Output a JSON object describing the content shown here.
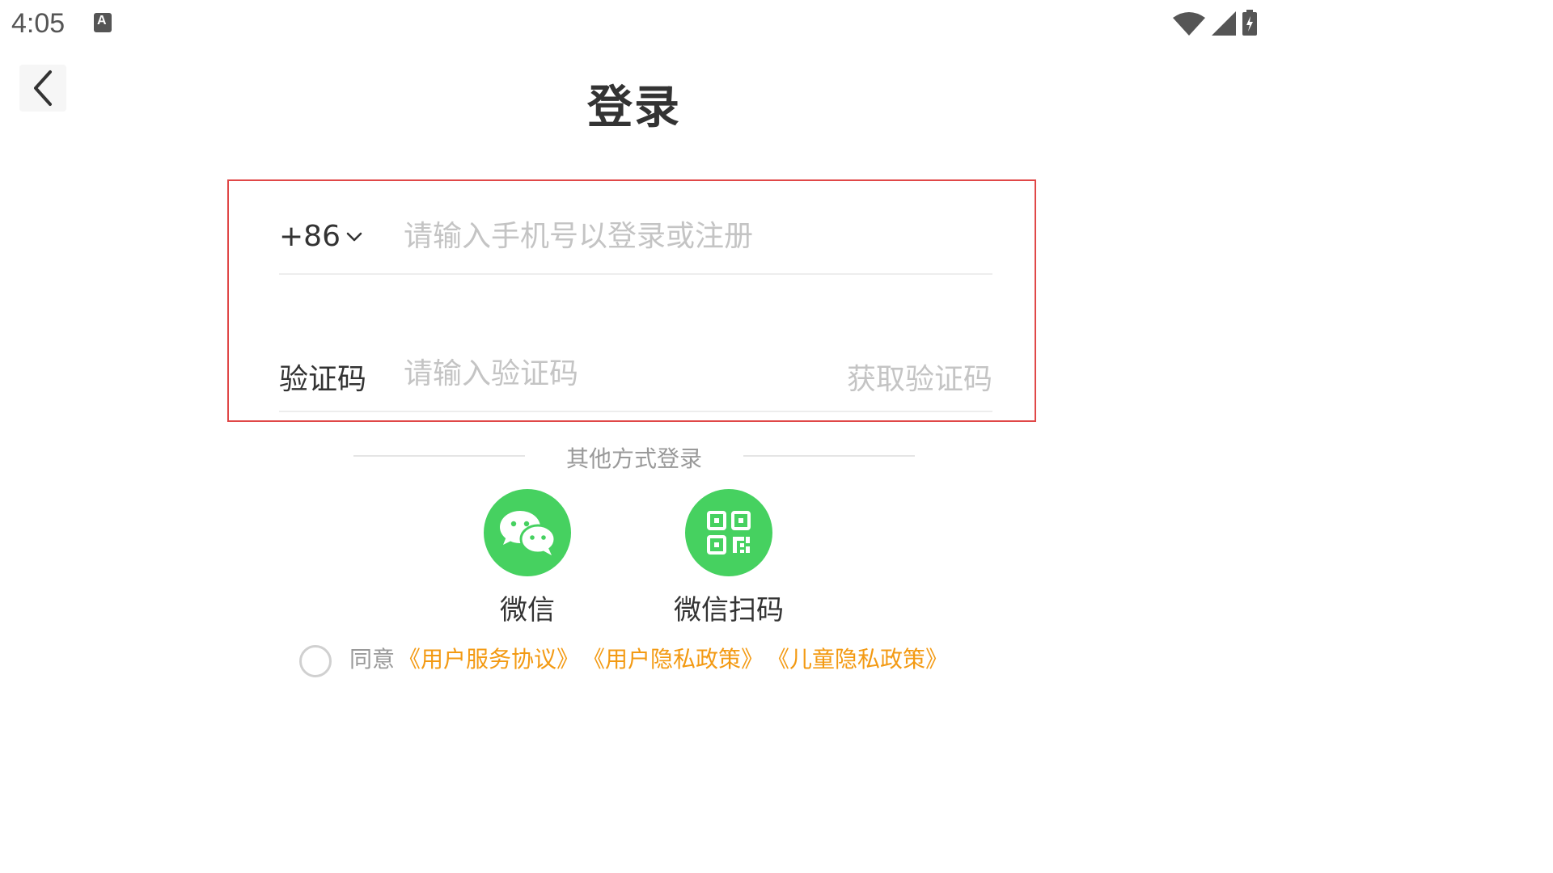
{
  "status_bar": {
    "time": "4:05"
  },
  "header": {
    "title": "登录"
  },
  "form": {
    "country_code": "+86",
    "phone_placeholder": "请输入手机号以登录或注册",
    "code_label": "验证码",
    "code_placeholder": "请输入验证码",
    "get_code_label": "获取验证码"
  },
  "other_login": {
    "label": "其他方式登录",
    "options": [
      {
        "label": "微信",
        "icon": "wechat-icon"
      },
      {
        "label": "微信扫码",
        "icon": "qr-code-icon"
      }
    ]
  },
  "agreement": {
    "prefix": "同意",
    "links": [
      "《用户服务协议》",
      "《用户隐私政策》",
      "《儿童隐私政策》"
    ]
  },
  "colors": {
    "accent_green": "#46d160",
    "link_orange": "#f39a13",
    "highlight_red": "#e04747"
  }
}
